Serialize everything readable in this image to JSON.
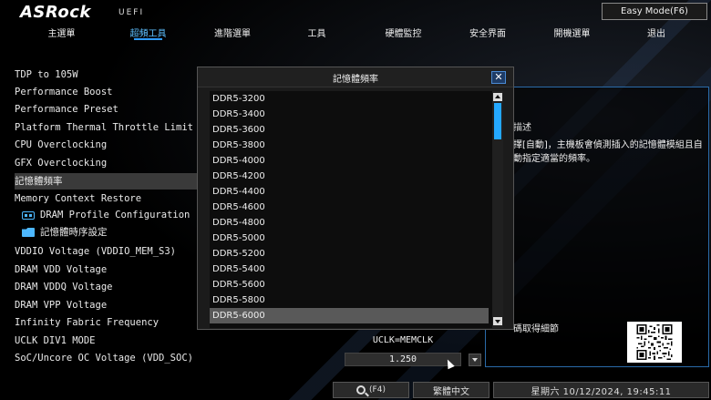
{
  "brand": {
    "logo": "ASRock",
    "mode": "UEFI"
  },
  "easy_mode_label": "Easy Mode(F6)",
  "menu": [
    {
      "label": "主選單"
    },
    {
      "label": "超頻工具"
    },
    {
      "label": "進階選單"
    },
    {
      "label": "工具"
    },
    {
      "label": "硬體監控"
    },
    {
      "label": "安全界面"
    },
    {
      "label": "開機選單"
    },
    {
      "label": "退出"
    }
  ],
  "settings": [
    {
      "label": "TDP to 105W"
    },
    {
      "label": "Performance Boost"
    },
    {
      "label": "Performance Preset"
    },
    {
      "label": " Platform Thermal Throttle Limit"
    },
    {
      "label": "CPU Overclocking"
    },
    {
      "label": "GFX Overclocking"
    },
    {
      "label": "記憶體頻率"
    },
    {
      "label": " Memory Context Restore"
    },
    {
      "label": "DRAM Profile Configuration",
      "icon": "dram-module-icon"
    },
    {
      "label": "記憶體時序設定",
      "icon": "folder-icon"
    },
    {
      "label": " VDDIO Voltage (VDDIO_MEM_S3)"
    },
    {
      "label": " DRAM VDD Voltage"
    },
    {
      "label": " DRAM VDDQ Voltage"
    },
    {
      "label": " DRAM VPP Voltage"
    },
    {
      "label": "Infinity Fabric Frequency"
    },
    {
      "label": "UCLK DIV1 MODE"
    },
    {
      "label": "SoC/Uncore OC Voltage (VDD_SOC)"
    }
  ],
  "values": {
    "uclk_div1_mode": "UCLK=MEMCLK",
    "soc_voltage": "1.250"
  },
  "description": {
    "title": "描述",
    "text": "擇[自動]，主機板會偵測插入的記憶體模組且自動指定適當的頻率。",
    "qr_hint": "碼取得細節"
  },
  "dialog": {
    "title": "記憶體頻率",
    "close": "✕",
    "options": [
      "DDR5-3200",
      "DDR5-3400",
      "DDR5-3600",
      "DDR5-3800",
      "DDR5-4000",
      "DDR5-4200",
      "DDR5-4400",
      "DDR5-4600",
      "DDR5-4800",
      "DDR5-5000",
      "DDR5-5200",
      "DDR5-5400",
      "DDR5-5600",
      "DDR5-5800",
      "DDR5-6000"
    ],
    "selected": "DDR5-6000"
  },
  "footer": {
    "search_label": "(F4)",
    "language": "繁體中文",
    "datetime": "星期六 10/12/2024, 19:45:11"
  }
}
